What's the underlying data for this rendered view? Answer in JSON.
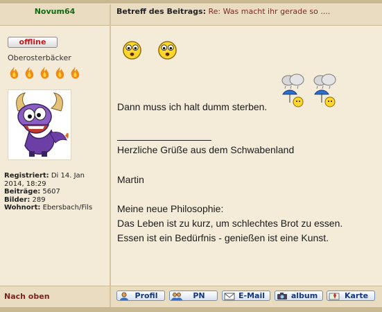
{
  "post": {
    "author": "Novum64",
    "subject_label": "Betreff des Beitrags:",
    "subject_text": "Re: Was macht ihr gerade so ....",
    "status": "offline",
    "rank": "Oberosterbäcker",
    "meta": {
      "registered_label": "Registriert:",
      "registered_value": "Di 14. Jan",
      "registered_value2": "2014, 18:29",
      "posts_label": "Beiträge:",
      "posts_value": "5607",
      "pics_label": "Bilder:",
      "pics_value": "289",
      "location_label": "Wohnort:",
      "location_value": "Ebersbach/Fils"
    },
    "message": {
      "line1": "Dann muss ich halt dumm sterben.",
      "sig_greeting": "Herzliche Grüße aus dem Schwabenland",
      "sig_name": "Martin",
      "sig_p1": "Meine neue Philosophie:",
      "sig_p2": "Das Leben ist zu kurz, um schlechtes Brot zu essen.",
      "sig_p3": "Essen ist ein Bedürfnis - genießen ist eine Kunst."
    }
  },
  "footer": {
    "back_to_top": "Nach oben",
    "buttons": {
      "profil": "Profil",
      "pn": "PN",
      "email": "E-Mail",
      "album": "album",
      "karte": "Karte"
    }
  },
  "colors": {
    "author": "#0f6b12",
    "offline": "#c01b1b",
    "nach_oben": "#7a2222",
    "button_text": "#14367a"
  }
}
